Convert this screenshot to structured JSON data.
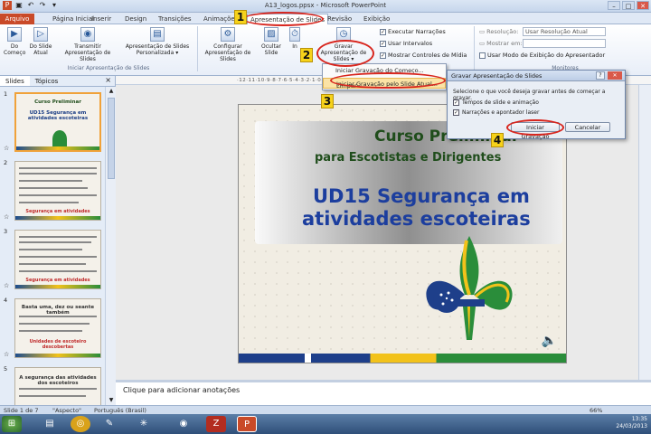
{
  "window": {
    "title": "A13_logos.ppsx - Microsoft PowerPoint"
  },
  "tabs": [
    "Arquivo",
    "Página Inicial",
    "Inserir",
    "Design",
    "Transições",
    "Animações",
    "Apresentação de Slides",
    "Revisão",
    "Exibição"
  ],
  "ribbon": {
    "do_comeco": "Do Começo",
    "do_slide_atual": "Do Slide Atual",
    "transmitir": "Transmitir Apresentação de Slides",
    "personalizada": "Apresentação de Slides Personalizada ▾",
    "group_iniciar": "Iniciar Apresentação de Slides",
    "configurar": "Configurar Apresentação de Slides",
    "ocultar": "Ocultar Slide",
    "intervalos": "In",
    "gravar": "Gravar Apresentação de Slides ▾",
    "executar_narracoes": "Executar Narrações",
    "usar_intervalos": "Usar Intervalos",
    "mostrar_controles": "Mostrar Controles de Mídia",
    "resolucao_label": "Resolução:",
    "resolucao_value": "Usar Resolução Atual",
    "mostrar_em_label": "Mostrar em:",
    "modo_apresentador": "Usar Modo de Exibição do Apresentador",
    "group_monitores": "Monitores"
  },
  "dropdown": {
    "item1": "Iniciar Gravação do Começo...",
    "item2": "Iniciar Gravação pelo Slide Atual...",
    "limpar": "Limpar"
  },
  "dialog": {
    "title": "Gravar Apresentação de Slides",
    "help": "?",
    "close": "✕",
    "prompt": "Selecione o que você deseja gravar antes de começar a gravar.",
    "opt1": "Tempos de slide e animação",
    "opt2": "Narrações e apontador laser",
    "start": "Iniciar Gravação",
    "cancel": "Cancelar"
  },
  "callouts": [
    "1",
    "2",
    "3",
    "4"
  ],
  "panel": {
    "tab_slides": "Slides",
    "tab_topicos": "Tópicos",
    "close": "×"
  },
  "thumbnails": [
    {
      "num": "1",
      "title": "Curso Preliminar",
      "title2": "UD15 Segurança em atividades escoteiras"
    },
    {
      "num": "2",
      "red": "Segurança em atividades"
    },
    {
      "num": "3",
      "red": "Segurança em atividades"
    },
    {
      "num": "4",
      "title": "Basta uma, dez ou seante também",
      "red": "Unidades de escoteiro descobertas"
    },
    {
      "num": "5",
      "title": "A segurança das atividades dos escoteiros"
    }
  ],
  "slide": {
    "line1": "Curso Preliminar",
    "line2": "para Escotistas e Dirigentes",
    "line3": "UD15 Segurança em",
    "line4": "atividades escoteiras"
  },
  "notes": "Clique para adicionar anotações",
  "status": {
    "slide": "Slide 1 de 7",
    "theme": "\"Aspecto\"",
    "lang": "Português (Brasil)",
    "zoom": "66%"
  },
  "tray": {
    "time": "13:35",
    "date": "24/03/2013"
  },
  "colors": {
    "file_tab": "#c94a28",
    "highlight": "#fbe3a6",
    "callout": "#f6d21a",
    "oval": "#d8261e"
  }
}
